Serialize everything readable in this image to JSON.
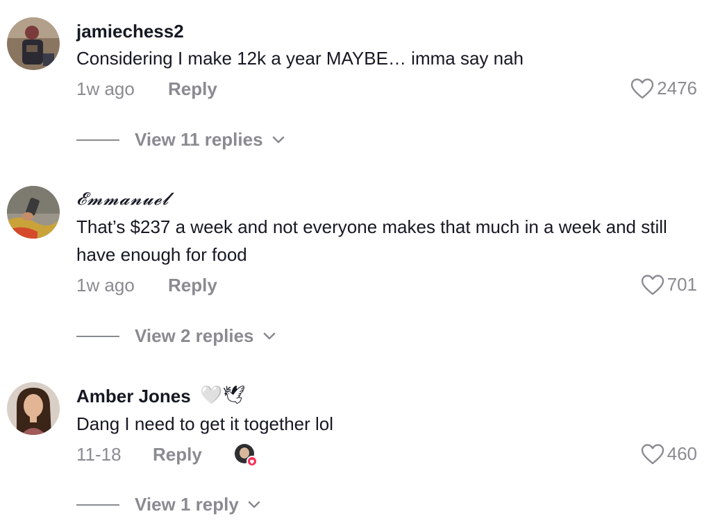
{
  "comments": [
    {
      "username": "jamiechess2",
      "text": "Considering I make 12k a year MAYBE… imma say nah",
      "time": "1w ago",
      "reply_label": "Reply",
      "likes": "2476",
      "view_replies": "View 11 replies"
    },
    {
      "username": "𝓔𝓶𝓶𝓪𝓷𝓾𝓮𝓵",
      "text": "That’s $237 a week and not everyone makes that much in a week and still have enough for food",
      "time": "1w ago",
      "reply_label": "Reply",
      "likes": "701",
      "view_replies": "View 2 replies"
    },
    {
      "username": "Amber Jones",
      "name_emojis": "🤍🕊",
      "text": "Dang I need to get it together lol",
      "time": "11-18",
      "reply_label": "Reply",
      "likes": "460",
      "view_replies": "View 1 reply"
    }
  ],
  "colors": {
    "primary_text": "#161823",
    "secondary_text": "#8a8b91",
    "creator_like_badge": "#fe2c55"
  },
  "icons": {
    "like": "heart-outline-icon",
    "expand": "chevron-down-icon",
    "creator_liked": "creator-liked-avatar-icon"
  }
}
